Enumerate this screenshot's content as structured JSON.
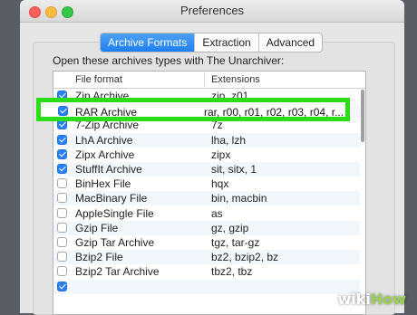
{
  "window": {
    "title": "Preferences"
  },
  "tabs": [
    {
      "label": "Archive Formats",
      "active": true
    },
    {
      "label": "Extraction",
      "active": false
    },
    {
      "label": "Advanced",
      "active": false
    }
  ],
  "prompt": "Open these archives types with The Unarchiver:",
  "table": {
    "headers": {
      "format": "File format",
      "extensions": "Extensions"
    },
    "rows": [
      {
        "format": "Zip Archive",
        "extensions": "zip, z01",
        "checked": true
      },
      {
        "format": "RAR Archive",
        "extensions": "rar, r00, r01, r02, r03, r04, r...",
        "checked": true
      },
      {
        "format": "7-Zip Archive",
        "extensions": "7z",
        "checked": true
      },
      {
        "format": "LhA Archive",
        "extensions": "lha, lzh",
        "checked": true
      },
      {
        "format": "Zipx Archive",
        "extensions": "zipx",
        "checked": true
      },
      {
        "format": "StuffIt Archive",
        "extensions": "sit, sitx, 1",
        "checked": true
      },
      {
        "format": "BinHex File",
        "extensions": "hqx",
        "checked": false
      },
      {
        "format": "MacBinary File",
        "extensions": "bin, macbin",
        "checked": false
      },
      {
        "format": "AppleSingle File",
        "extensions": "as",
        "checked": false
      },
      {
        "format": "Gzip File",
        "extensions": "gz, gzip",
        "checked": false
      },
      {
        "format": "Gzip Tar Archive",
        "extensions": "tgz, tar-gz",
        "checked": false
      },
      {
        "format": "Bzip2 File",
        "extensions": "bz2, bzip2, bz",
        "checked": false
      },
      {
        "format": "Bzip2 Tar Archive",
        "extensions": "tbz2, tbz",
        "checked": false
      },
      {
        "format": "",
        "extensions": "",
        "checked": true
      }
    ]
  },
  "highlight_color": "#2bdd16",
  "watermark": {
    "wiki": "wiki",
    "how": "How"
  }
}
